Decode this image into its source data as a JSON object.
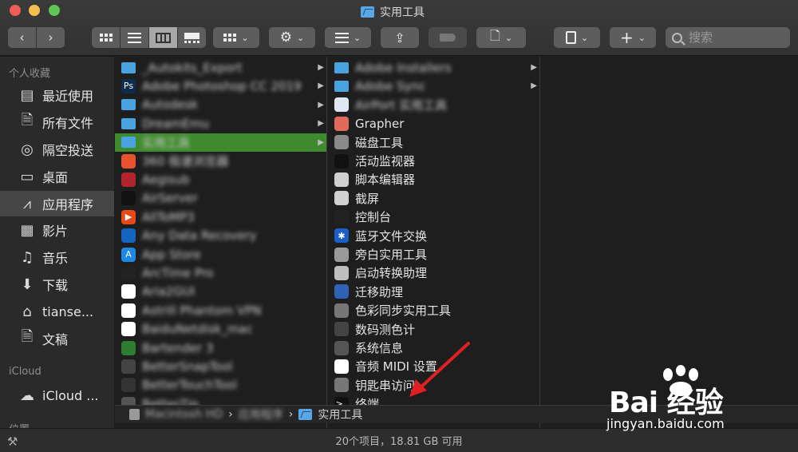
{
  "window": {
    "title": "实用工具"
  },
  "toolbar": {
    "search_placeholder": "搜索"
  },
  "sidebar": {
    "section_favorites": "个人收藏",
    "favorites": [
      {
        "label": "最近使用",
        "icon": "recents-icon"
      },
      {
        "label": "所有文件",
        "icon": "all-files-icon"
      },
      {
        "label": "隔空投送",
        "icon": "airdrop-icon"
      },
      {
        "label": "桌面",
        "icon": "desktop-icon"
      },
      {
        "label": "应用程序",
        "icon": "applications-icon",
        "selected": true
      },
      {
        "label": "影片",
        "icon": "movies-icon"
      },
      {
        "label": "音乐",
        "icon": "music-icon"
      },
      {
        "label": "下载",
        "icon": "downloads-icon"
      },
      {
        "label": "tianse...",
        "icon": "home-icon"
      },
      {
        "label": "文稿",
        "icon": "documents-icon"
      }
    ],
    "section_icloud": "iCloud",
    "icloud_item": "iCloud ...",
    "section_locations": "位置"
  },
  "column1": [
    {
      "label": "_Autokits_Export",
      "blurred": true,
      "color": "#4aa3e0",
      "folder": true,
      "arrow": true
    },
    {
      "label": "Adobe Photoshop CC 2019",
      "blurred": true,
      "color": "#0d2c4e",
      "glyph": "Ps",
      "arrow": true
    },
    {
      "label": "Autodesk",
      "blurred": true,
      "color": "#4aa3e0",
      "folder": true,
      "arrow": true
    },
    {
      "label": "DreamEmu",
      "blurred": true,
      "color": "#4aa3e0",
      "folder": true,
      "arrow": true
    },
    {
      "label": "实用工具",
      "blurred": true,
      "color": "#4aa3e0",
      "folder": true,
      "arrow": true,
      "selected": true
    },
    {
      "label": "360 极速浏览器",
      "blurred": true,
      "color": "#e8532f",
      "glyph": ""
    },
    {
      "label": "Aegisub",
      "blurred": true,
      "color": "#b3252c",
      "glyph": ""
    },
    {
      "label": "AirServer",
      "blurred": true,
      "color": "#111111",
      "glyph": ""
    },
    {
      "label": "AllToMP3",
      "blurred": true,
      "color": "#e64a19",
      "glyph": "▶"
    },
    {
      "label": "Any Data Recovery",
      "blurred": true,
      "color": "#1565c0",
      "glyph": ""
    },
    {
      "label": "App Store",
      "blurred": true,
      "color": "#1e88e5",
      "glyph": "A"
    },
    {
      "label": "ArcTime Pro",
      "blurred": true,
      "color": "#222222",
      "glyph": ""
    },
    {
      "label": "Aria2GUI",
      "blurred": true,
      "color": "#ffffff",
      "glyph": ""
    },
    {
      "label": "Astrill Phantom VPN",
      "blurred": true,
      "color": "#ffffff",
      "glyph": ""
    },
    {
      "label": "BaiduNetdisk_mac",
      "blurred": true,
      "color": "#ffffff",
      "glyph": ""
    },
    {
      "label": "Bartender 3",
      "blurred": true,
      "color": "#2e7d32",
      "glyph": ""
    },
    {
      "label": "BetterSnapTool",
      "blurred": true,
      "color": "#444444",
      "glyph": ""
    },
    {
      "label": "BetterTouchTool",
      "blurred": true,
      "color": "#333333",
      "glyph": ""
    },
    {
      "label": "BetterZip",
      "blurred": true,
      "color": "#555555",
      "glyph": ""
    }
  ],
  "column2": [
    {
      "label": "Adobe Installers",
      "blurred": true,
      "color": "#4aa3e0",
      "folder": true,
      "arrow": true
    },
    {
      "label": "Adobe Sync",
      "blurred": true,
      "color": "#4aa3e0",
      "folder": true,
      "arrow": true
    },
    {
      "label": "AirPort 实用工具",
      "blurred": true,
      "color": "#dfe8f2",
      "glyph": ""
    },
    {
      "label": "Grapher",
      "color": "#e26a5a",
      "glyph": ""
    },
    {
      "label": "磁盘工具",
      "color": "#8a8a8a",
      "glyph": ""
    },
    {
      "label": "活动监视器",
      "color": "#111111",
      "glyph": ""
    },
    {
      "label": "脚本编辑器",
      "color": "#cfcfcf",
      "glyph": ""
    },
    {
      "label": "截屏",
      "color": "#cfcfcf",
      "glyph": ""
    },
    {
      "label": "控制台",
      "color": "#222222",
      "glyph": ""
    },
    {
      "label": "蓝牙文件交换",
      "color": "#1d5fc9",
      "glyph": "✱"
    },
    {
      "label": "旁白实用工具",
      "color": "#9a9a9a",
      "glyph": ""
    },
    {
      "label": "启动转换助理",
      "color": "#bdbdbd",
      "glyph": ""
    },
    {
      "label": "迁移助理",
      "color": "#2f62b5",
      "glyph": ""
    },
    {
      "label": "色彩同步实用工具",
      "color": "#777777",
      "glyph": ""
    },
    {
      "label": "数码测色计",
      "color": "#444444",
      "glyph": ""
    },
    {
      "label": "系统信息",
      "color": "#555555",
      "glyph": ""
    },
    {
      "label": "音频 MIDI 设置",
      "color": "#ffffff",
      "glyph": ""
    },
    {
      "label": "钥匙串访问",
      "color": "#777777",
      "glyph": ""
    },
    {
      "label": "终端",
      "color": "#111111",
      "glyph": ">_"
    }
  ],
  "pathbar": {
    "segments_blurred": [
      "Macintosh HD",
      "应用程序"
    ],
    "current": "实用工具"
  },
  "status": {
    "text": "20个项目，18.81 GB 可用"
  },
  "watermark": {
    "main": "Bai 经验",
    "sub": "jingyan.baidu.com"
  },
  "colors": {
    "selection_green": "#3f8a2e",
    "folder_blue": "#4aa3e0",
    "annotation_red": "#e02020"
  }
}
